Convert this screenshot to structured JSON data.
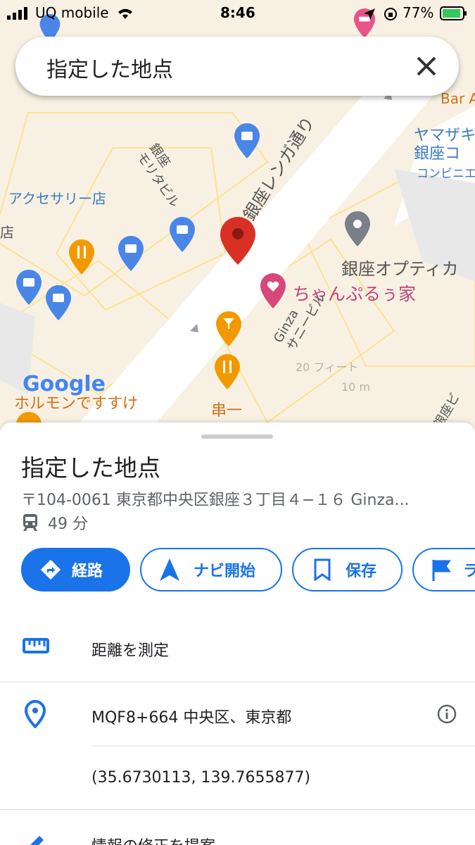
{
  "status_bar": {
    "carrier": "UQ mobile",
    "time": "8:46",
    "battery": "77%"
  },
  "search": {
    "query": "指定した地点"
  },
  "map": {
    "street_label": "銀座レンガ通り",
    "labels": {
      "moritabiru": "銀座\nモリタビル",
      "accessory": "アクセサリー店",
      "optica": "銀座オプティカ",
      "champuru": "ちゃんぷるぅ家",
      "ginza_sunny": "Ginza\nサニービル",
      "kushiichi": "串一",
      "horumon": "ホルモンですすけ",
      "yamazaki": "ヤマザキ\n銀座コ",
      "konbini": "コンビニエ",
      "bar": "Bar A",
      "ryu": "隆銀座ビ",
      "scale_ft": "20 フィート",
      "scale_m": "10 m",
      "google_logo": "Google",
      "ten": "店"
    }
  },
  "place": {
    "title": "指定した地点",
    "address": "〒104-0061 東京都中央区銀座３丁目４−１６ Ginza...",
    "transit_time": "49 分"
  },
  "actions": [
    {
      "label": "経路",
      "icon": "directions-icon"
    },
    {
      "label": "ナビ開始",
      "icon": "navigation-icon"
    },
    {
      "label": "保存",
      "icon": "bookmark-icon"
    },
    {
      "label": "ラ",
      "icon": "flag-icon"
    }
  ],
  "list": {
    "measure": "距離を測定",
    "plus_code": "MQF8+664 中央区、東京都",
    "coords": "(35.6730113, 139.7655877)",
    "suggest_edit": "情報の修正を提案"
  },
  "colors": {
    "accent": "#1a73e8",
    "pin": "#d93025",
    "road": "#ffffff",
    "map_bg": "#f8f1e3"
  }
}
